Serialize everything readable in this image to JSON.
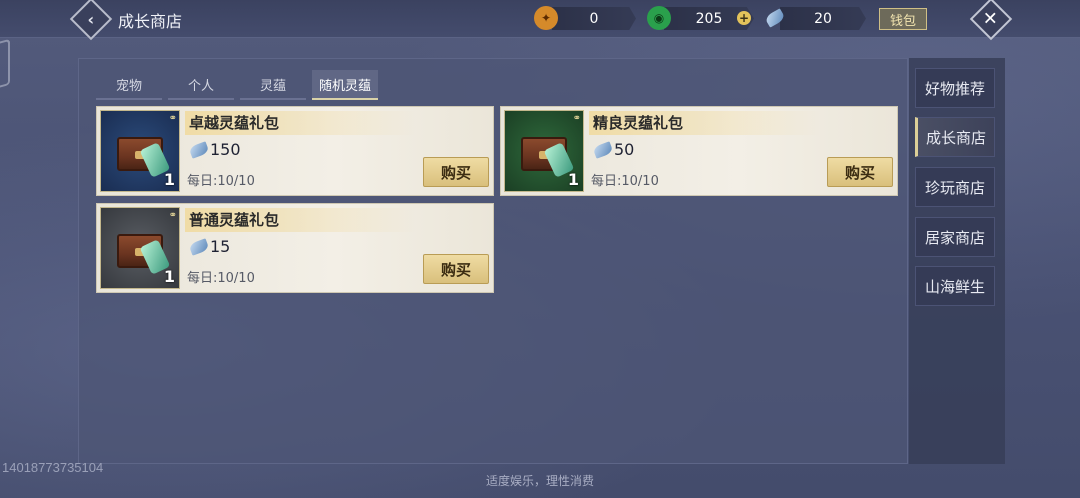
{
  "header": {
    "title": "成长商店",
    "wallet_label": "钱包"
  },
  "currencies": [
    {
      "name": "gold-token",
      "value": "0"
    },
    {
      "name": "jade-coin",
      "value": "205"
    },
    {
      "name": "spirit-feather",
      "value": "20"
    }
  ],
  "tabs": [
    {
      "label": "宠物"
    },
    {
      "label": "个人"
    },
    {
      "label": "灵蕴"
    },
    {
      "label": "随机灵蕴",
      "active": true
    }
  ],
  "items": [
    {
      "name": "卓越灵蕴礼包",
      "price": "150",
      "daily": "每日:10/10",
      "count": "1",
      "buy_label": "购买"
    },
    {
      "name": "精良灵蕴礼包",
      "price": "50",
      "daily": "每日:10/10",
      "count": "1",
      "buy_label": "购买"
    },
    {
      "name": "普通灵蕴礼包",
      "price": "15",
      "daily": "每日:10/10",
      "count": "1",
      "buy_label": "购买"
    }
  ],
  "sidebar": [
    {
      "label": "好物推荐"
    },
    {
      "label": "成长商店",
      "active": true
    },
    {
      "label": "珍玩商店"
    },
    {
      "label": "居家商店"
    },
    {
      "label": "山海鲜生"
    }
  ],
  "footer": {
    "id_text": "14018773735104",
    "notice": "适度娱乐，理性消费"
  }
}
